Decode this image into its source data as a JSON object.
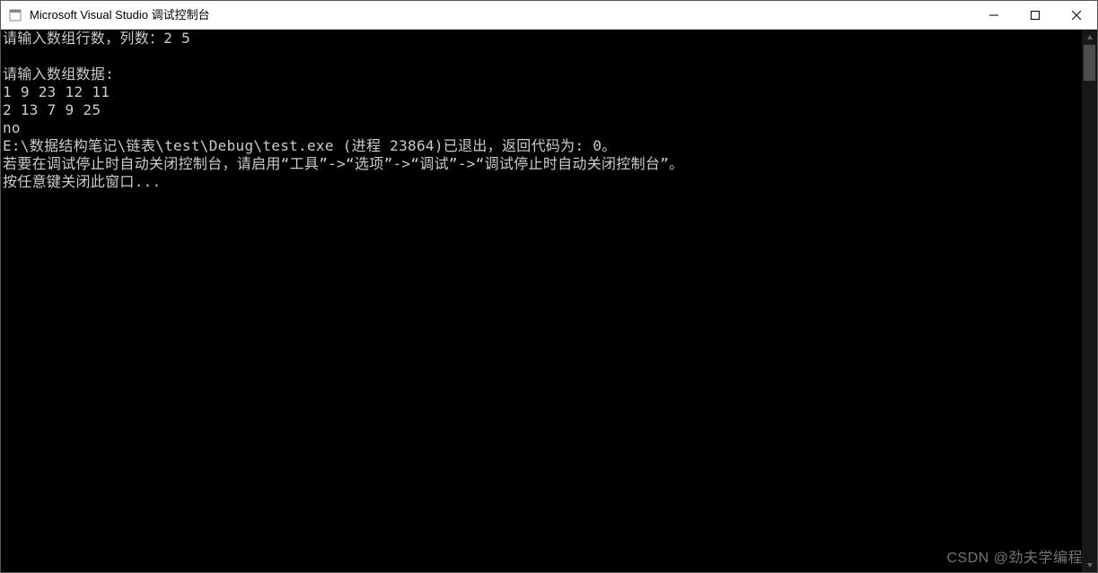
{
  "window": {
    "title": "Microsoft Visual Studio 调试控制台"
  },
  "console": {
    "lines": [
      "请输入数组行数，列数：2 5",
      "",
      "请输入数组数据:",
      "1 9 23 12 11",
      "2 13 7 9 25",
      "no",
      "E:\\数据结构笔记\\链表\\test\\Debug\\test.exe (进程 23864)已退出，返回代码为: 0。",
      "若要在调试停止时自动关闭控制台，请启用“工具”->“选项”->“调试”->“调试停止时自动关闭控制台”。",
      "按任意键关闭此窗口..."
    ]
  },
  "watermark": "CSDN @劲夫学编程"
}
